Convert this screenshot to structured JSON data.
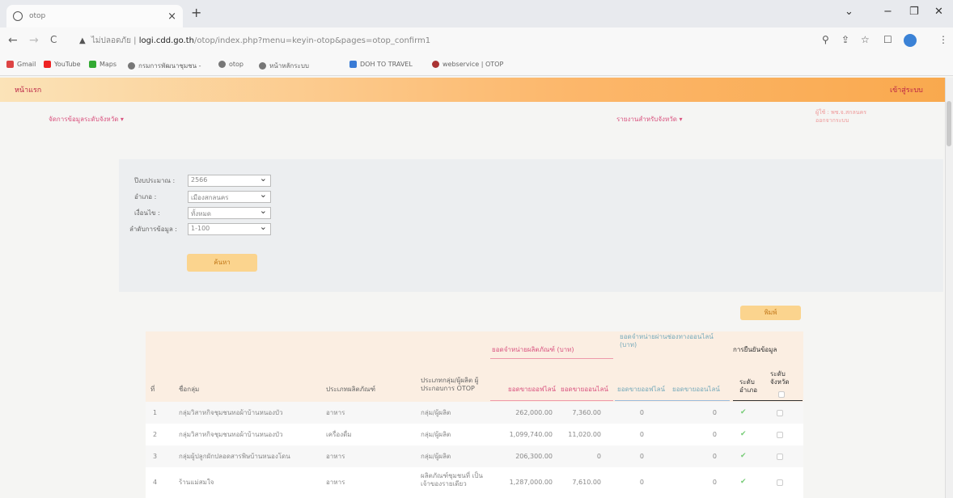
{
  "browser": {
    "tab_title": "otop",
    "tab_close": "×",
    "new_tab": "+",
    "win_min": "−",
    "win_restore": "❐",
    "win_close": "✕",
    "win_menu": "⌄",
    "back": "←",
    "forward": "→",
    "reload": "C",
    "security_warning": "▲",
    "not_secure_text": "ไม่ปลอดภัย |",
    "url_host": "logi.cdd.go.th",
    "url_path": "/otop/index.php?menu=keyin-otop&pages=otop_confirm1",
    "bookmarks": [
      "Gmail",
      "YouTube",
      "Maps",
      "กรมการพัฒนาชุมชน -",
      "otop",
      "หน้าหลักระบบ",
      "DOH TO TRAVEL",
      "webservice | OTOP"
    ]
  },
  "page": {
    "home_link": "หน้าแรก",
    "login_link": "เข้าสู่ระบบ",
    "nav_left": "จัดการข้อมูลระดับจังหวัด ▾",
    "nav_right": "รายงานสำหรับจังหวัด ▾",
    "user_line1": "ผู้ใช้ : พช.จ.สกลนคร",
    "user_line2": "ออกจากระบบ"
  },
  "filters": [
    {
      "label": "ปีงบประมาณ :",
      "value": "2566"
    },
    {
      "label": "อำเภอ :",
      "value": "เมืองสกลนคร"
    },
    {
      "label": "เงื่อนไข :",
      "value": "ทั้งหมด"
    },
    {
      "label": "ลำดับการข้อมูล :",
      "value": "1-100"
    }
  ],
  "search_button": "ค้นหา",
  "print_button": "พิมพ์",
  "table": {
    "group_income": "ยอดจำหน่ายผลิตภัณฑ์ (บาท)",
    "group_expense": "ยอดจำหน่ายผ่านช่องทางออนไลน์ (บาท)",
    "group_confirm": "การยืนยันข้อมูล",
    "col_no": "ที่",
    "col_name": "ชื่อกลุ่ม",
    "col_type": "ประเภทผลิตภัณฑ์",
    "col_entrepreneur": "ประเภทกลุ่ม/ผู้ผลิต ผู้ประกอบการ OTOP",
    "col_income_offline": "ยอดขายออฟไลน์",
    "col_income_online": "ยอดขายออนไลน์",
    "col_exp_offline": "ยอดขายออฟไลน์",
    "col_exp_online": "ยอดขายออนไลน์",
    "col_amphoe": "ระดับ อำเภอ",
    "col_province": "ระดับ จังหวัด",
    "rows": [
      {
        "no": "1",
        "name": "กลุ่มวิสาหกิจชุมชนทอผ้าบ้านหนองบัว",
        "type": "อาหาร",
        "ent": "กลุ่ม/ผู้ผลิต",
        "inc_off": "262,000.00",
        "inc_on": "7,360.00",
        "exp_off": "0",
        "exp_on": "0"
      },
      {
        "no": "2",
        "name": "กลุ่มวิสาหกิจชุมชนทอผ้าบ้านหนองบัว",
        "type": "เครื่องดื่ม",
        "ent": "กลุ่ม/ผู้ผลิต",
        "inc_off": "1,099,740.00",
        "inc_on": "11,020.00",
        "exp_off": "0",
        "exp_on": "0"
      },
      {
        "no": "3",
        "name": "กลุ่มผู้ปลูกผักปลอดสารพิษบ้านหนองโดน",
        "type": "อาหาร",
        "ent": "กลุ่ม/ผู้ผลิต",
        "inc_off": "206,300.00",
        "inc_on": "0",
        "exp_off": "0",
        "exp_on": "0"
      },
      {
        "no": "4",
        "name": "ร้านแม่สมใจ",
        "type": "อาหาร",
        "ent": "ผลิตภัณฑ์ชุมชนที่ เป็นเจ้าของรายเดียว",
        "inc_off": "1,287,000.00",
        "inc_on": "7,610.00",
        "exp_off": "0",
        "exp_on": "0"
      }
    ]
  },
  "colors": {
    "accent": "#f9a94e",
    "header_bg": "#fbeee2",
    "link": "#d9537f"
  }
}
